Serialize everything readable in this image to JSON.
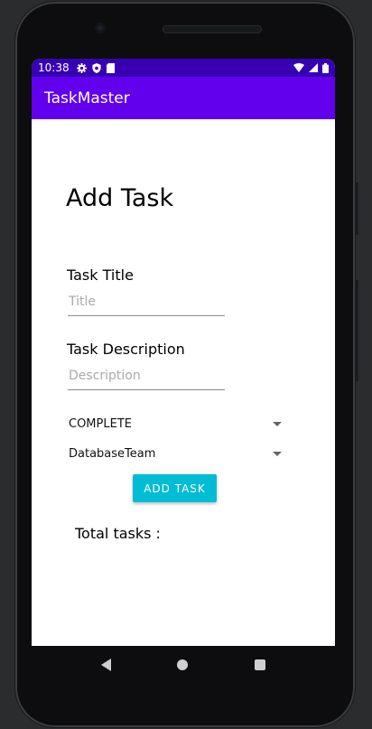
{
  "status_bar": {
    "time": "10:38",
    "icons": [
      "settings-icon",
      "shield-icon",
      "sd-card-icon",
      "wifi-icon",
      "signal-icon",
      "battery-icon"
    ]
  },
  "app_bar": {
    "title": "TaskMaster"
  },
  "form": {
    "heading": "Add Task",
    "title_label": "Task Title",
    "title_placeholder": "Title",
    "title_value": "",
    "description_label": "Task Description",
    "description_placeholder": "Description",
    "description_value": "",
    "status_selected": "COMPLETE",
    "team_selected": "DatabaseTeam",
    "add_button_label": "ADD TASK",
    "total_tasks_label": "Total tasks :"
  },
  "colors": {
    "status_bar": "#3700b3",
    "app_bar": "#6200ee",
    "accent_button": "#00bcd4"
  }
}
